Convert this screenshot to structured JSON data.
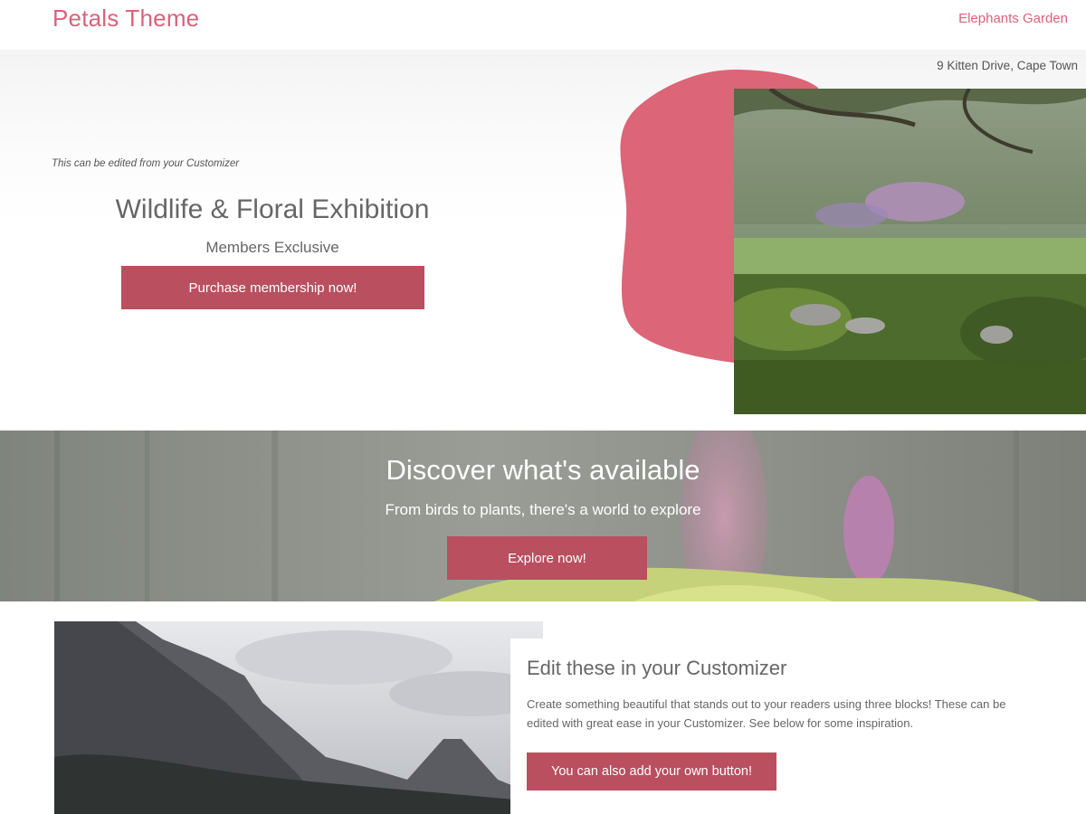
{
  "header": {
    "site_title": "Petals Theme",
    "nav_link": "Elephants Garden"
  },
  "hero": {
    "address": "9 Kitten Drive, Cape Town",
    "customizer_note": "This can be edited from your Customizer",
    "title": "Wildlife & Floral Exhibition",
    "subtitle": "Members Exclusive",
    "button_label": "Purchase membership now!"
  },
  "discover": {
    "title": "Discover what's available",
    "subtitle": "From birds to plants, there's a world to explore",
    "button_label": "Explore now!"
  },
  "feature": {
    "title": "Edit these in your Customizer",
    "text": "Create something beautiful that stands out to your readers using three blocks! These can be edited with great ease in your Customizer. See below for some inspiration.",
    "button_label": "You can also add your own button!"
  },
  "colors": {
    "brand_pink": "#d9627a",
    "button": "#b94f5f",
    "blob": "#dc6577"
  }
}
